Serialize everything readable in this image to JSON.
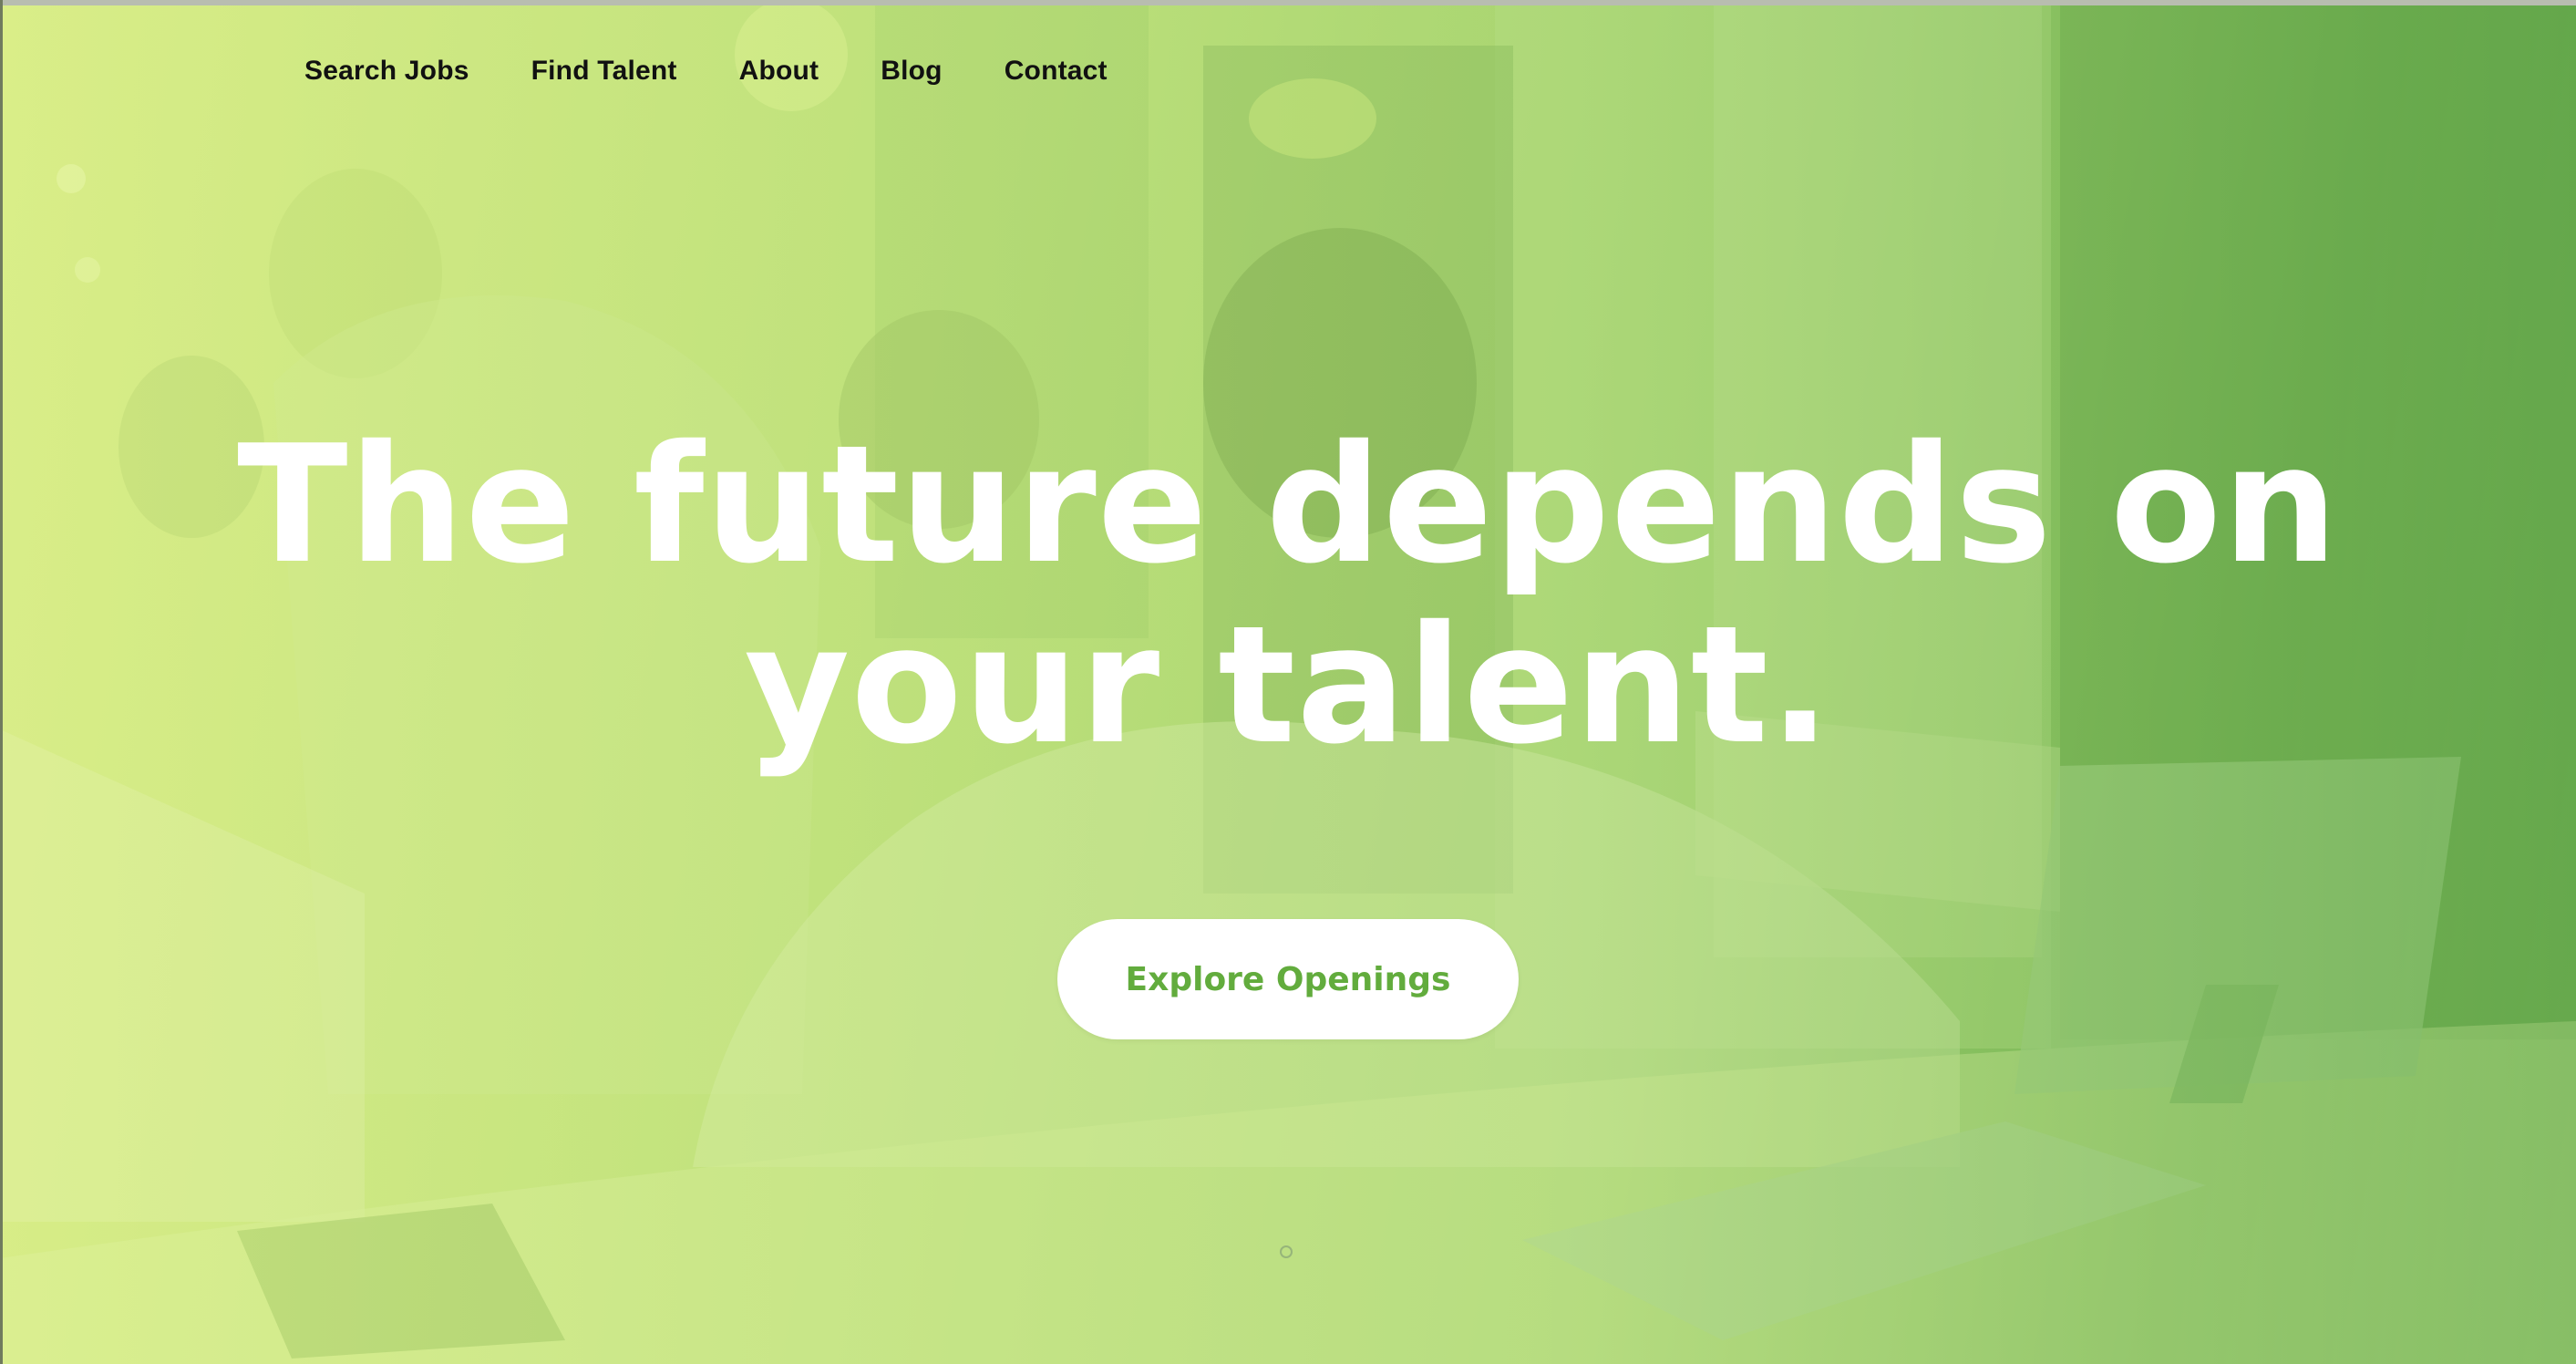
{
  "nav": {
    "items": [
      {
        "label": "Search Jobs"
      },
      {
        "label": "Find Talent"
      },
      {
        "label": "About"
      },
      {
        "label": "Blog"
      },
      {
        "label": "Contact"
      }
    ],
    "active": "About"
  },
  "hero": {
    "headline_line1": "The future depends on",
    "headline_line2": "your talent.",
    "cta_label": "Explore Openings"
  },
  "colors": {
    "overlay_light": "#d7ec86",
    "overlay_dark": "#6fb152",
    "cta_text": "#62ac3d",
    "headline": "#ffffff",
    "nav_text": "#111111"
  },
  "icons": {
    "scroll_indicator": "scroll-dot-icon"
  }
}
